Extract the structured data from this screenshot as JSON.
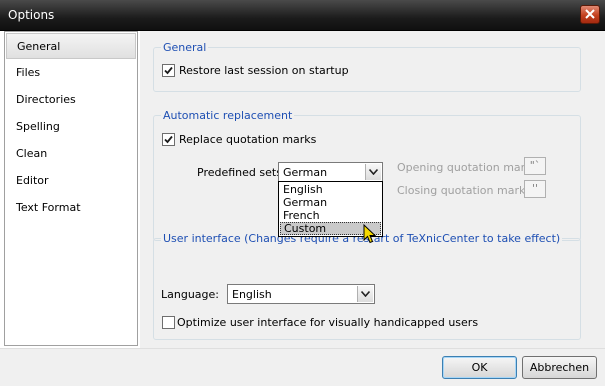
{
  "window": {
    "title": "Options",
    "close_icon": "close-icon"
  },
  "sidebar": {
    "items": [
      {
        "label": "General",
        "selected": true
      },
      {
        "label": "Files"
      },
      {
        "label": "Directories"
      },
      {
        "label": "Spelling"
      },
      {
        "label": "Clean"
      },
      {
        "label": "Editor"
      },
      {
        "label": "Text Format"
      }
    ]
  },
  "general_group": {
    "title": "General",
    "restore_session": {
      "label": "Restore last session on startup",
      "checked": true
    }
  },
  "replacement_group": {
    "title": "Automatic replacement",
    "replace_quotes": {
      "label": "Replace quotation marks",
      "checked": true
    },
    "predefined_sets_label": "Predefined sets:",
    "predefined_sets_value": "German",
    "options": [
      "English",
      "German",
      "French",
      "Custom"
    ],
    "highlighted_option": "Custom",
    "opening_label": "Opening quotation marks:",
    "opening_value": "\"`",
    "closing_label": "Closing quotation marks:",
    "closing_value": "''"
  },
  "ui_group": {
    "title": "User interface (Changes require a restart of TeXnicCenter to take effect)",
    "language_label": "Language:",
    "language_value": "English",
    "optimize": {
      "label": "Optimize user interface for visually handicapped users",
      "checked": false
    }
  },
  "footer": {
    "ok_label": "OK",
    "cancel_label": "Abbrechen"
  },
  "colors": {
    "accent": "#1e4fb3",
    "titlebar": "#1c1c1c",
    "close": "#c4401e"
  }
}
